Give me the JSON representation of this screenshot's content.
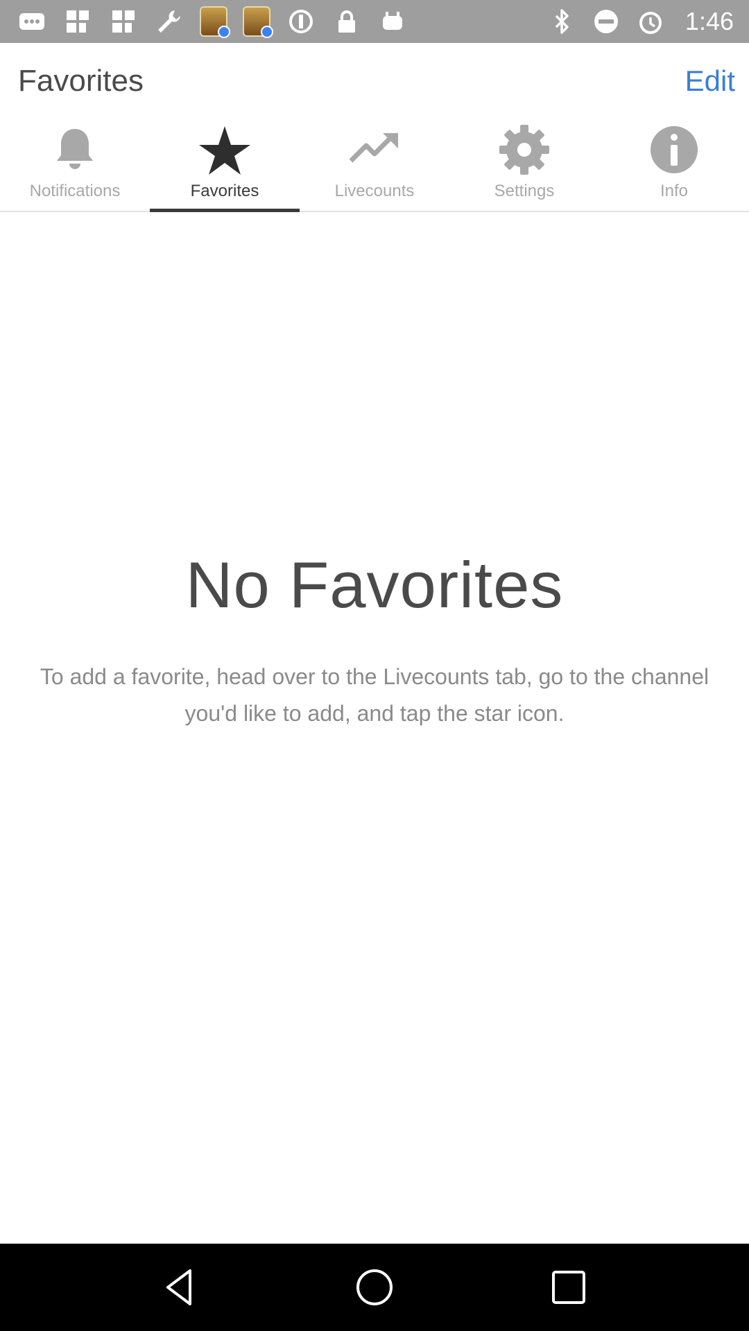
{
  "status_bar": {
    "time": "1:46",
    "left_icons": [
      "more-icon",
      "grid-icon",
      "grid-icon",
      "wrench-icon",
      "app-topics-icon",
      "app-topics-icon",
      "sync-icon",
      "lock-icon",
      "android-icon"
    ],
    "right_icons": [
      "bluetooth-icon",
      "do-not-disturb-icon",
      "alarm-icon"
    ]
  },
  "header": {
    "title": "Favorites",
    "edit_label": "Edit"
  },
  "tabs": [
    {
      "label": "Notifications",
      "icon": "bell-icon",
      "active": false
    },
    {
      "label": "Favorites",
      "icon": "star-icon",
      "active": true
    },
    {
      "label": "Livecounts",
      "icon": "trending-up-icon",
      "active": false
    },
    {
      "label": "Settings",
      "icon": "gear-icon",
      "active": false
    },
    {
      "label": "Info",
      "icon": "info-icon",
      "active": false
    }
  ],
  "empty_state": {
    "title": "No Favorites",
    "message": "To add a favorite, head over to the Livecounts tab, go to the channel you'd like to add, and tap the star icon."
  },
  "colors": {
    "accent": "#3a7fd5",
    "status_bar": "#9e9e9e",
    "active_tab": "#3a3a3a",
    "inactive_tab": "#a8a8a8"
  },
  "nav_bar": {
    "buttons": [
      "back-icon",
      "home-icon",
      "recents-icon"
    ]
  }
}
